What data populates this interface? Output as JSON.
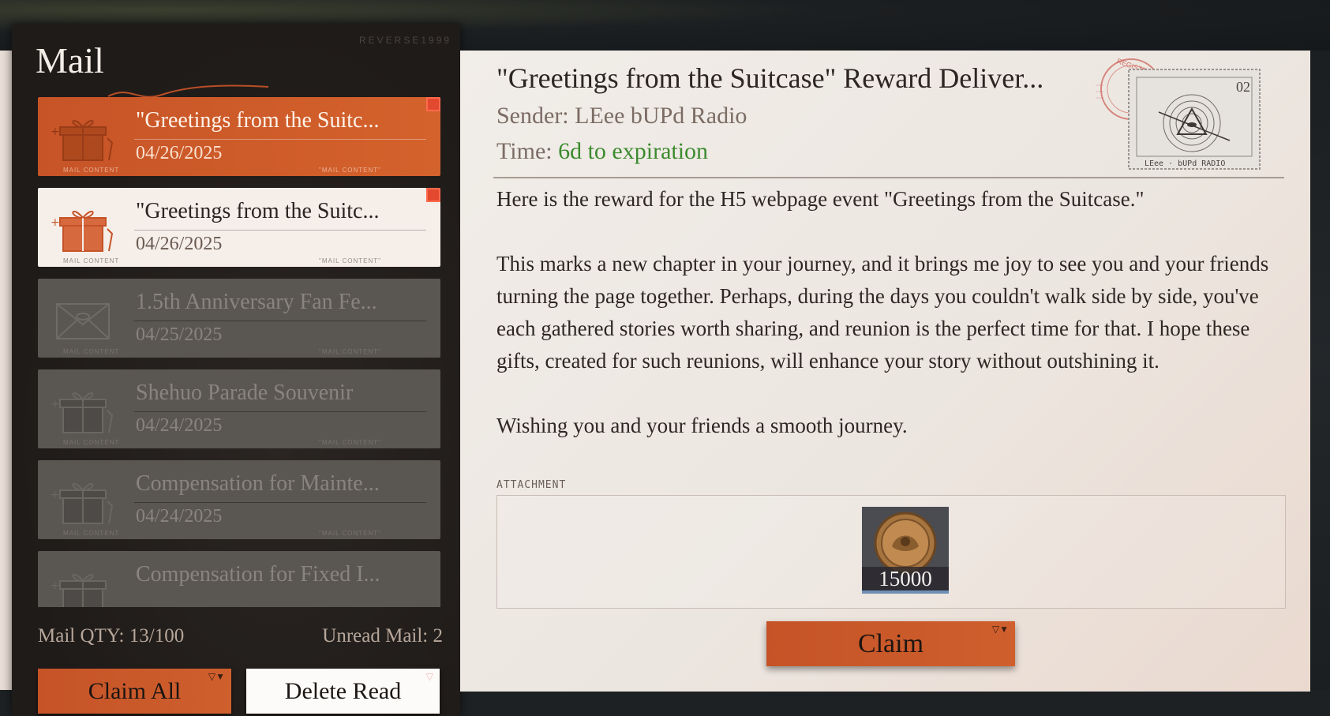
{
  "brand": "REVERSE1999",
  "panel_title": "Mail",
  "mail_items": [
    {
      "title": "\"Greetings from the Suitc...",
      "date": "04/26/2025",
      "state": "active",
      "unread": true,
      "icon": "gift-icon"
    },
    {
      "title": "\"Greetings from the Suitc...",
      "date": "04/26/2025",
      "state": "unread",
      "unread": true,
      "icon": "gift-icon"
    },
    {
      "title": "1.5th Anniversary Fan Fe...",
      "date": "04/25/2025",
      "state": "read",
      "unread": false,
      "icon": "envelope-icon"
    },
    {
      "title": "Shehuo Parade Souvenir",
      "date": "04/24/2025",
      "state": "read",
      "unread": false,
      "icon": "gift-icon"
    },
    {
      "title": "Compensation for Mainte...",
      "date": "04/24/2025",
      "state": "read",
      "unread": false,
      "icon": "gift-icon"
    },
    {
      "title": "Compensation for Fixed I...",
      "date": "",
      "state": "read",
      "unread": false,
      "icon": "gift-icon"
    }
  ],
  "mail_item_tag_left": "MAIL CONTENT",
  "mail_item_tag_right": "\"MAIL CONTENT\"",
  "mail_qty": "Mail QTY: 13/100",
  "unread_mail": "Unread Mail: 2",
  "buttons": {
    "claim_all": "Claim All",
    "delete_read": "Delete Read",
    "claim": "Claim"
  },
  "detail": {
    "title": "\"Greetings from the Suitcase\" Reward Deliver...",
    "sender_label": "Sender: LEee bUPd Radio",
    "time_label": "Time: ",
    "time_value": "6d to expiration",
    "paragraph_1": "Here is the reward for the H5 webpage event \"Greetings from the Suitcase.\"",
    "paragraph_2": "This marks a new chapter in your journey, and it brings me joy to see you and your friends turning the page together. Perhaps, during the days you couldn't walk side by side, you've each gathered stories worth sharing, and reunion is the perfect time for that. I hope these gifts, created for such reunions, will enhance your story without outshining it.",
    "paragraph_3": "Wishing you and your friends a smooth journey.",
    "attachment_label": "ATTACHMENT",
    "attachment_count": "15000",
    "stamp_number": "02",
    "stamp_footer": "LEee · bUPd RADIO",
    "seal_text": "REGISTERED"
  },
  "colors": {
    "accent_orange": "#cf5f2d",
    "unread_red": "#e3492f",
    "expiry_green": "#3c8a2e"
  }
}
